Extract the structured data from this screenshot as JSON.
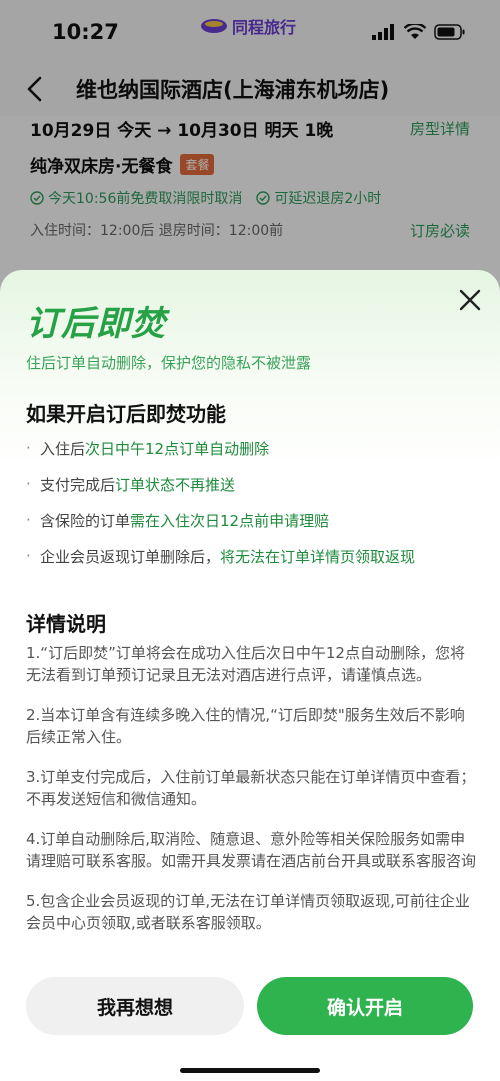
{
  "status_bar": {
    "time": "10:27",
    "brand": "同程旅行",
    "brand_color": "#6b3fd1",
    "icons": [
      "signal-icon",
      "wifi-icon",
      "battery-icon"
    ]
  },
  "header": {
    "title": "维也纳国际酒店(上海浦东机场店)",
    "back_icon": "chevron-left-icon"
  },
  "booking": {
    "dates": "10月29日 今天 → 10月30日 明天 1晚",
    "room_detail_link": "房型详情",
    "room": "纯净双床房·无餐食",
    "room_tag": "套餐",
    "policy_cancel": "今天10:56前免费取消限时取消",
    "policy_checkout": "可延迟退房2小时",
    "times": "入住时间：12:00后 退房时间：12:00前",
    "must_read": "订房必读"
  },
  "sheet": {
    "title": "订后即焚",
    "subtitle": "住后订单自动删除，保护您的隐私不被泄露",
    "accent_color": "#27a146",
    "features_heading": "如果开启订后即焚功能",
    "features": [
      {
        "plain": "入住后",
        "highlight": "次日中午12点订单自动删除"
      },
      {
        "plain": "支付完成后",
        "highlight": "订单状态不再推送"
      },
      {
        "plain": "含保险的订单",
        "highlight": "需在入住次日12点前申请理赔"
      },
      {
        "plain": "企业会员返现订单删除后，",
        "highlight": "将无法在订单详情页领取返现"
      }
    ],
    "details_heading": "详情说明",
    "details": [
      "1.“订后即焚”订单将会在成功入住后次日中午12点自动删除，您将无法看到订单预订记录且无法对酒店进行点评，请谨慎点选。",
      "2.当本订单含有连续多晚入住的情况,“订后即焚\"服务生效后不影响后续正常入住。",
      "3.订单支付完成后，入住前订单最新状态只能在订单详情页中查看；不再发送短信和微信通知。",
      "4.订单自动删除后,取消险、随意退、意外险等相关保险服务如需申请理赔可联系客服。如需开具发票请在酒店前台开具或联系客服咨询",
      "5.包含企业会员返现的订单,无法在订单详情页领取返现,可前往企业会员中心页领取,或者联系客服领取。"
    ],
    "btn_think": "我再想想",
    "btn_confirm": "确认开启"
  }
}
